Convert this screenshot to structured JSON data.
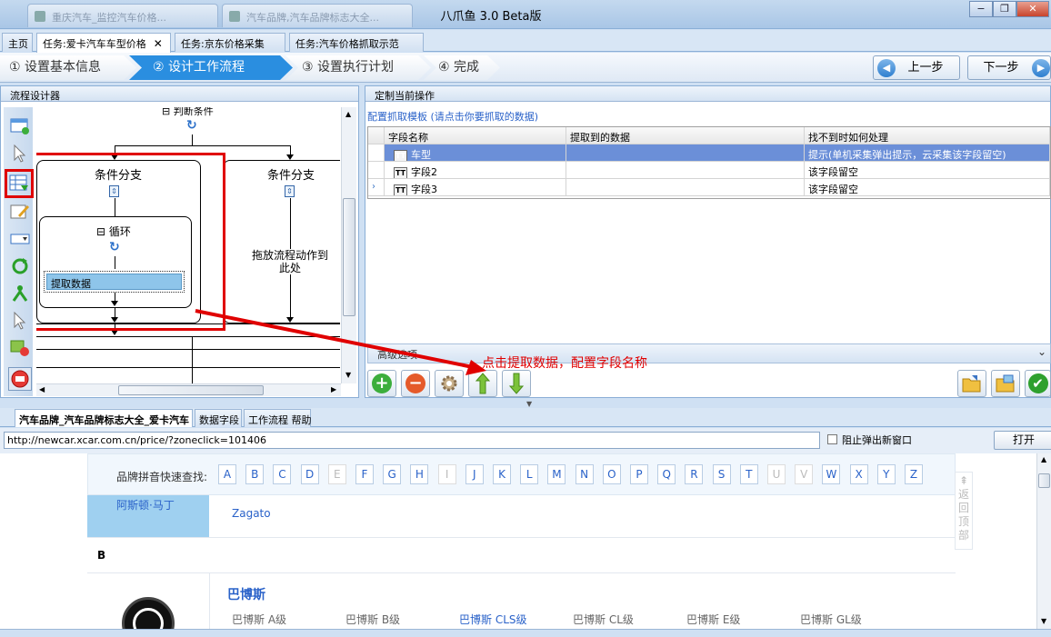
{
  "window": {
    "title": "八爪鱼 3.0 Beta版",
    "os_tabs": [
      "重庆汽车_监控汽车价格...",
      "汽车品牌,汽车品牌标志大全..."
    ],
    "controls": {
      "minimize": "−",
      "maximize": "❐",
      "close": "✕"
    }
  },
  "task_tabs": [
    {
      "label": "主页"
    },
    {
      "label": "任务:爱卡汽车车型价格",
      "close": "✕"
    },
    {
      "label": "任务:京东价格采集"
    },
    {
      "label": "任务:汽车价格抓取示范"
    }
  ],
  "steps": [
    {
      "label": "① 设置基本信息"
    },
    {
      "label": "② 设计工作流程"
    },
    {
      "label": "③ 设置执行计划"
    },
    {
      "label": "④ 完成"
    }
  ],
  "nav": {
    "prev": "上一步",
    "next": "下一步",
    "prev_icon": "◀",
    "next_icon": "▶"
  },
  "flow_designer": {
    "title": "流程设计器",
    "top_label": "判断条件",
    "branch_left": "条件分支",
    "branch_right": "条件分支",
    "loop_label": "循环",
    "extract_node": "提取数据",
    "drop_hint": "拖放流程动作到此处"
  },
  "custom_op": {
    "title": "定制当前操作",
    "template_link": "配置抓取模板 (请点击你要抓取的数据)",
    "columns": [
      "字段名称",
      "提取到的数据",
      "找不到时如何处理"
    ],
    "rows": [
      {
        "name": "车型",
        "data": "",
        "handling": "提示(单机采集弹出提示，云采集该字段留空)"
      },
      {
        "name": "字段2",
        "data": "",
        "handling": "该字段留空"
      },
      {
        "name": "字段3",
        "data": "",
        "handling": "该字段留空"
      }
    ],
    "advanced": "高级选项"
  },
  "annotation": "点击提取数据，配置字段名称",
  "browser_tabs": [
    {
      "label": "汽车品牌_汽车品牌标志大全_爱卡汽车"
    },
    {
      "label": "数据字段"
    },
    {
      "label": "工作流程 帮助"
    }
  ],
  "address": {
    "url": "http://newcar.xcar.com.cn/price/?zoneclick=101406",
    "block_popup": "阻止弹出新窗口",
    "open": "打开"
  },
  "webpage": {
    "brand_search_label": "品牌拼音快速查找:",
    "letters": [
      "A",
      "B",
      "C",
      "D",
      "E",
      "F",
      "G",
      "H",
      "I",
      "J",
      "K",
      "L",
      "M",
      "N",
      "O",
      "P",
      "Q",
      "R",
      "S",
      "T",
      "U",
      "V",
      "W",
      "X",
      "Y",
      "Z"
    ],
    "disabled_letters": [
      "E",
      "I",
      "U",
      "V"
    ],
    "brand_selected": "阿斯顿·马丁",
    "brand_sub": "Zagato",
    "section_letter": "B",
    "brand_name": "巴博斯",
    "models": [
      "巴博斯 A级",
      "巴博斯 B级",
      "巴博斯 CLS级",
      "巴博斯 CL级",
      "巴博斯 E级",
      "巴博斯 GL级"
    ],
    "back_to_top": "返回顶部"
  },
  "colors": {
    "accent": "#2a8ee0",
    "highlight_red": "#ff0000",
    "selected_row": "#6b8fd8"
  }
}
